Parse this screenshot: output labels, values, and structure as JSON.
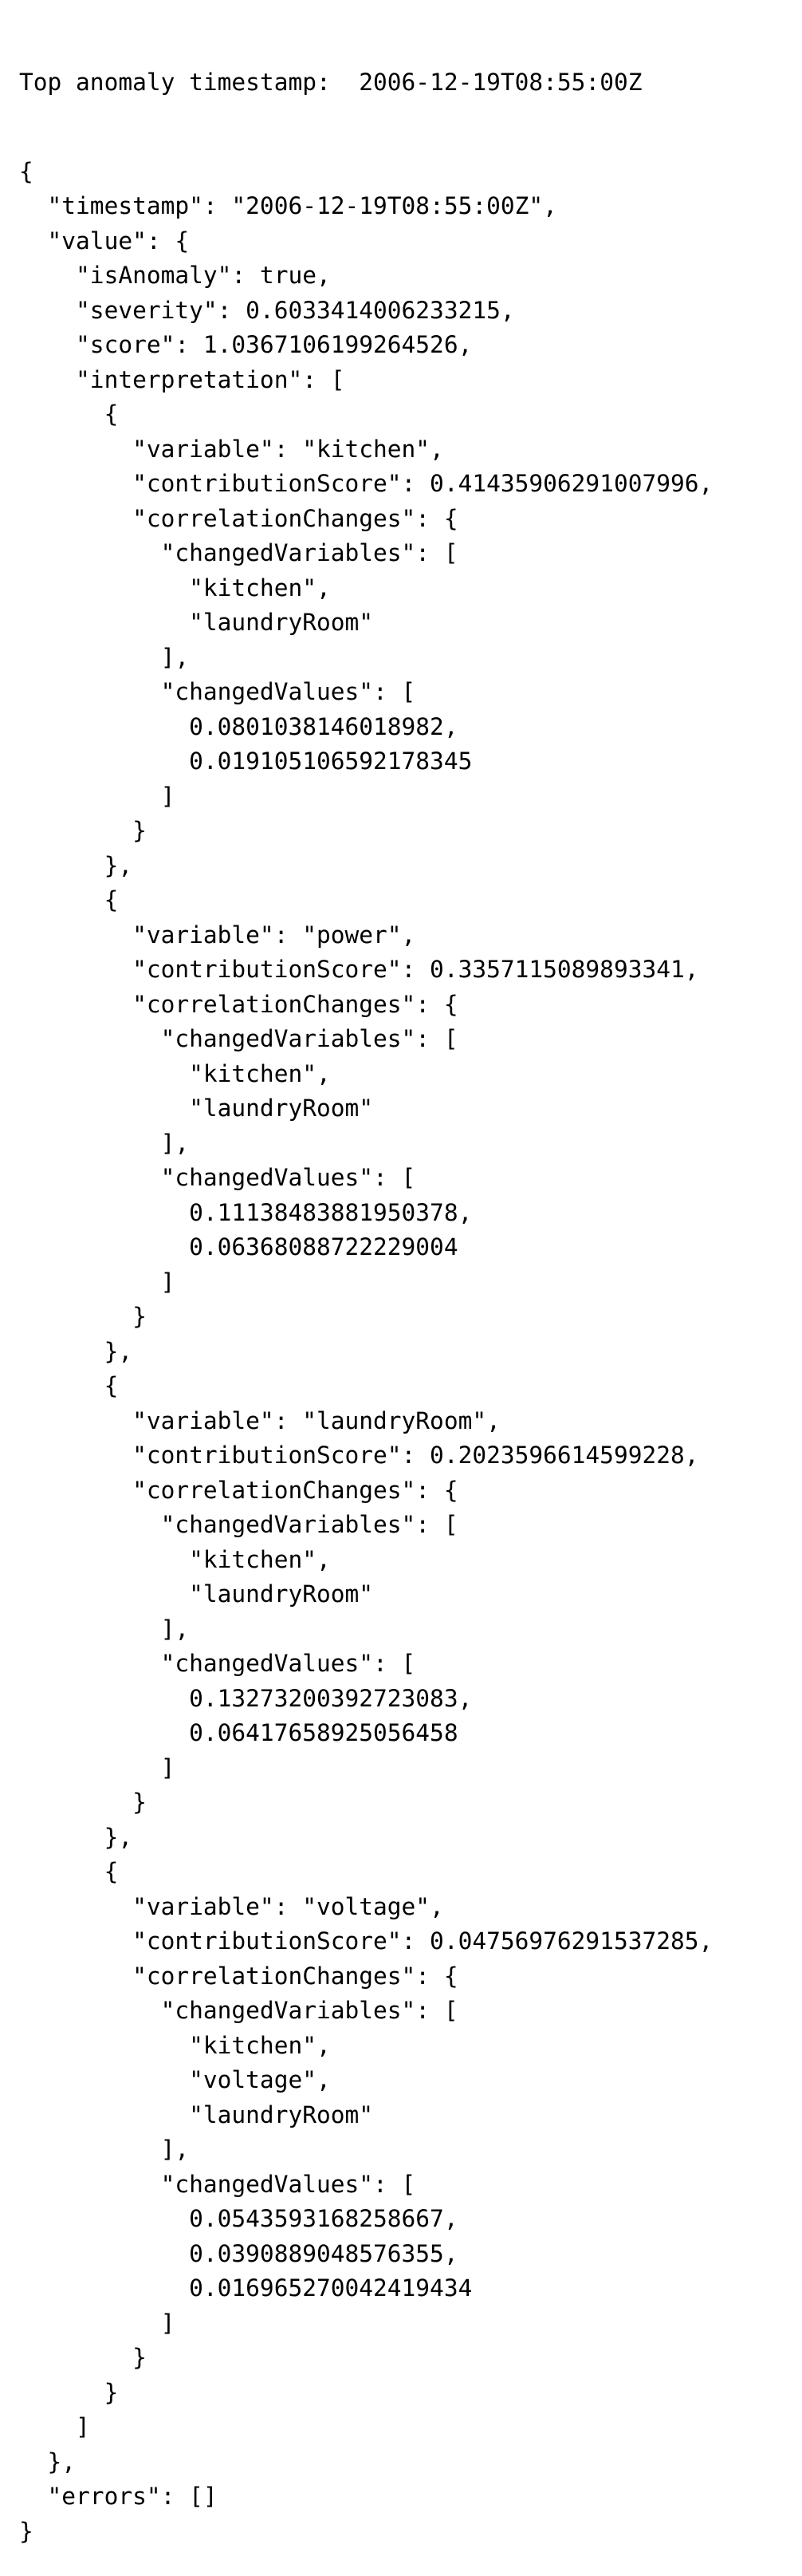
{
  "header": {
    "label": "Top anomaly timestamp:",
    "timestamp": "2006-12-19T08:55:00Z"
  },
  "json_output_lines": [
    "{",
    "  \"timestamp\": \"2006-12-19T08:55:00Z\",",
    "  \"value\": {",
    "    \"isAnomaly\": true,",
    "    \"severity\": 0.6033414006233215,",
    "    \"score\": 1.0367106199264526,",
    "    \"interpretation\": [",
    "      {",
    "        \"variable\": \"kitchen\",",
    "        \"contributionScore\": 0.41435906291007996,",
    "        \"correlationChanges\": {",
    "          \"changedVariables\": [",
    "            \"kitchen\",",
    "            \"laundryRoom\"",
    "          ],",
    "          \"changedValues\": [",
    "            0.0801038146018982,",
    "            0.019105106592178345",
    "          ]",
    "        }",
    "      },",
    "      {",
    "        \"variable\": \"power\",",
    "        \"contributionScore\": 0.3357115089893341,",
    "        \"correlationChanges\": {",
    "          \"changedVariables\": [",
    "            \"kitchen\",",
    "            \"laundryRoom\"",
    "          ],",
    "          \"changedValues\": [",
    "            0.11138483881950378,",
    "            0.06368088722229004",
    "          ]",
    "        }",
    "      },",
    "      {",
    "        \"variable\": \"laundryRoom\",",
    "        \"contributionScore\": 0.2023596614599228,",
    "        \"correlationChanges\": {",
    "          \"changedVariables\": [",
    "            \"kitchen\",",
    "            \"laundryRoom\"",
    "          ],",
    "          \"changedValues\": [",
    "            0.13273200392723083,",
    "            0.06417658925056458",
    "          ]",
    "        }",
    "      },",
    "      {",
    "        \"variable\": \"voltage\",",
    "        \"contributionScore\": 0.04756976291537285,",
    "        \"correlationChanges\": {",
    "          \"changedVariables\": [",
    "            \"kitchen\",",
    "            \"voltage\",",
    "            \"laundryRoom\"",
    "          ],",
    "          \"changedValues\": [",
    "            0.0543593168258667,",
    "            0.0390889048576355,",
    "            0.016965270042419434",
    "          ]",
    "        }",
    "      }",
    "    ]",
    "  },",
    "  \"errors\": []",
    "}"
  ]
}
